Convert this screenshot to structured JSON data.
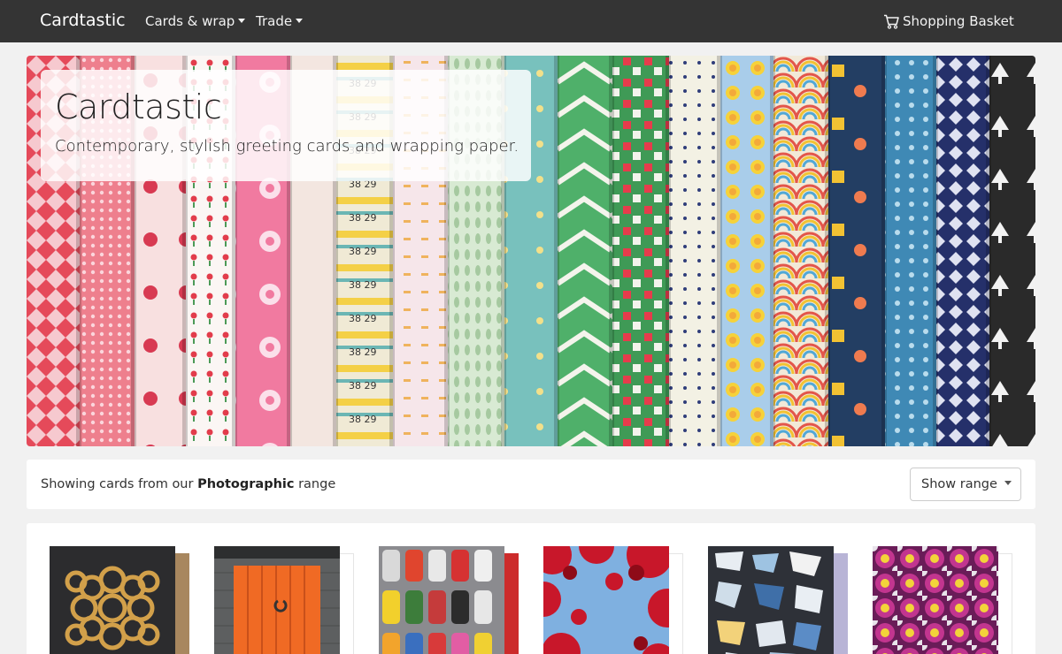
{
  "navbar": {
    "brand": "Cardtastic",
    "links": [
      {
        "label": "Cards & wrap"
      },
      {
        "label": "Trade"
      }
    ],
    "basket_label": "Shopping Basket"
  },
  "hero": {
    "title": "Cardtastic",
    "subtitle": "Contemporary, stylish greeting cards and wrapping paper."
  },
  "range": {
    "prefix": "Showing cards from our ",
    "name": "Photographic",
    "suffix": " range",
    "button_label": "Show range"
  },
  "colors": {
    "navbar": "#343434",
    "page_bg": "#f1f1f1",
    "panel": "#ffffff"
  },
  "products": [
    {
      "name": "pretzel-card",
      "envelope": "#a8875f"
    },
    {
      "name": "orange-door-card",
      "envelope": "#ffffff"
    },
    {
      "name": "toy-cars-card",
      "envelope": "#cc2b2b"
    },
    {
      "name": "red-leaves-card",
      "envelope": "#ffffff"
    },
    {
      "name": "broken-china-card",
      "envelope": "#b8b4d6"
    },
    {
      "name": "flowers-card",
      "envelope": "#ffffff"
    }
  ]
}
